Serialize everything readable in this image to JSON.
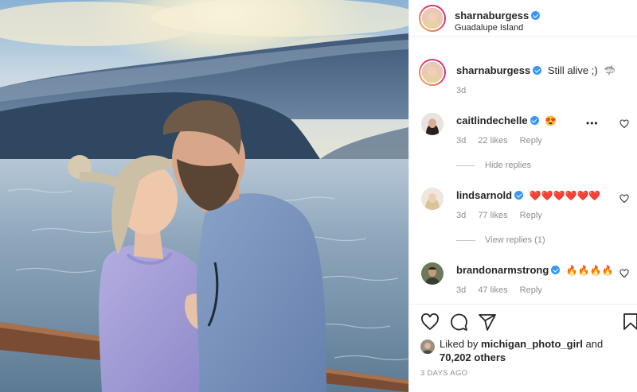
{
  "post": {
    "author": "sharnaburgess",
    "location": "Guadalupe Island",
    "caption": "Still alive ;)",
    "caption_emoji": "🦈",
    "caption_age": "3d",
    "likes_line_prefix": "Liked by",
    "liked_by": "michigan_photo_girl",
    "likes_line_and": "and",
    "others": "70,202 others",
    "date": "3 DAYS AGO"
  },
  "comments": [
    {
      "user": "caitlindechelle",
      "emoji": "😍",
      "age": "3d",
      "likes": "22 likes",
      "reply": "Reply",
      "thread_toggle": "Hide replies",
      "more": "•••"
    },
    {
      "user": "lindsarnold",
      "emoji": "❤️❤️❤️❤️❤️❤️",
      "age": "3d",
      "likes": "77 likes",
      "reply": "Reply",
      "thread_toggle": "View replies (1)"
    },
    {
      "user": "brandonarmstrong",
      "emoji": "🔥🔥🔥🔥",
      "age": "3d",
      "likes": "47 likes",
      "reply": "Reply"
    }
  ],
  "icons": {
    "like": "heart-icon",
    "comment": "comment-icon",
    "share": "paper-plane-icon",
    "save": "bookmark-icon",
    "verified": "verified-badge-icon",
    "more": "more-options-icon"
  },
  "colors": {
    "link_blue": "#3897f0",
    "secondary_text": "#8e8e8e",
    "primary_text": "#262626",
    "story_ring_start": "#f9c041",
    "story_ring_end": "#c13584"
  }
}
